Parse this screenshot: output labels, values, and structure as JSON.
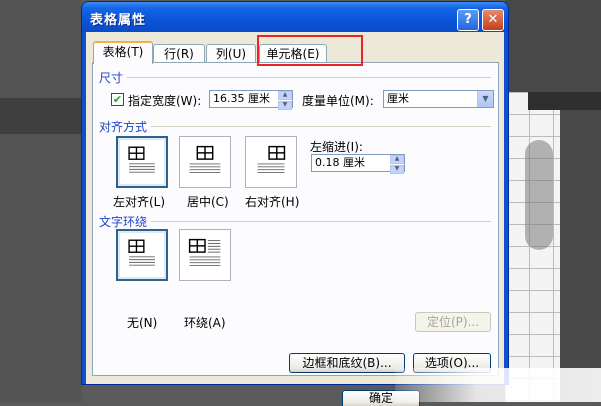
{
  "dialog": {
    "title": "表格属性",
    "help_glyph": "?",
    "close_glyph": "✕"
  },
  "tabs": [
    {
      "label": "表格(T)",
      "active": true
    },
    {
      "label": "行(R)",
      "active": false
    },
    {
      "label": "列(U)",
      "active": false
    },
    {
      "label": "单元格(E)",
      "active": false
    }
  ],
  "size_section": {
    "header": "尺寸",
    "specify_width_label": "指定宽度(W):",
    "specify_width_checked": true,
    "width_value": "16.35 厘米",
    "measure_in_label": "度量单位(M):",
    "measure_in_value": "厘米"
  },
  "alignment_section": {
    "header": "对齐方式",
    "options": [
      {
        "label": "左对齐(L)",
        "selected": true
      },
      {
        "label": "居中(C)",
        "selected": false
      },
      {
        "label": "右对齐(H)",
        "selected": false
      }
    ],
    "indent_label": "左缩进(I):",
    "indent_value": "0.18 厘米"
  },
  "wrapping_section": {
    "header": "文字环绕",
    "options": [
      {
        "label": "无(N)",
        "selected": true
      },
      {
        "label": "环绕(A)",
        "selected": false
      }
    ],
    "positioning_button": "定位(P)..."
  },
  "footer": {
    "borders_button": "边框和底纹(B)...",
    "options_button": "选项(O)...",
    "ok_button": "确定"
  },
  "colors": {
    "title_bar": "#0b54d8",
    "group_header": "#1e44c8",
    "highlight": "#e8252b"
  }
}
